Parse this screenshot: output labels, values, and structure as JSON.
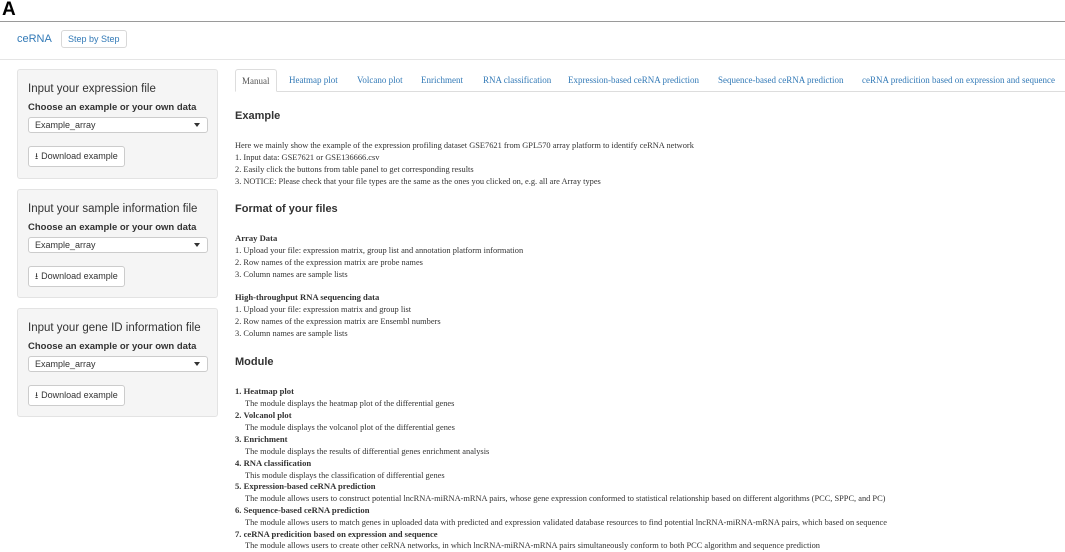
{
  "figure_label": "A",
  "navbar": {
    "brand": "ceRNA",
    "step_button": "Step by Step"
  },
  "sidebar": {
    "wells": [
      {
        "title": "Input your expression file",
        "subtitle": "Choose an example or your own data",
        "selected": "Example_array",
        "download": "Download example"
      },
      {
        "title": "Input your sample information file",
        "subtitle": "Choose an example or your own data",
        "selected": "Example_array",
        "download": "Download example"
      },
      {
        "title": "Input your gene ID information file",
        "subtitle": "Choose an example or your own data",
        "selected": "Example_array",
        "download": "Download example"
      }
    ]
  },
  "tabs": [
    "Manual",
    "Heatmap plot",
    "Volcano plot",
    "Enrichment",
    "RNA classification",
    "Expression-based ceRNA prediction",
    "Sequence-based ceRNA prediction",
    "ceRNA predicition based on expression and sequence"
  ],
  "main": {
    "example_heading": "Example",
    "example_lines": [
      "Here we mainly show the example of the expression profiling dataset GSE7621 from GPL570 array platform to identify ceRNA network",
      "1. Input data: GSE7621 or GSE136666.csv",
      "2. Easily click the buttons from table panel to get corresponding results",
      "3. NOTICE: Please check that your file types are the same as the ones you clicked on, e.g. all are Array types"
    ],
    "format_heading": "Format of your files",
    "array_title": "Array Data",
    "array_lines": [
      "1. Upload your file: expression matrix, group list and annotation platform information",
      "2. Row names of the expression matrix are probe names",
      "3. Column names are sample lists"
    ],
    "rnaseq_title": "High-throughput RNA sequencing data",
    "rnaseq_lines": [
      "1. Upload your file: expression matrix and group list",
      "2. Row names of the expression matrix are Ensembl numbers",
      "3. Column names are sample lists"
    ],
    "module_heading": "Module",
    "modules": [
      {
        "title": "1. Heatmap plot",
        "desc": "The module displays the heatmap plot of the differential genes"
      },
      {
        "title": "2. Volcanol plot",
        "desc": "The module displays the volcanol plot of the differential genes"
      },
      {
        "title": "3. Enrichment",
        "desc": "The module displays the results of differential genes enrichment analysis"
      },
      {
        "title": "4. RNA classification",
        "desc": "This module displays the classification of differential genes"
      },
      {
        "title": "5. Expression-based ceRNA prediction",
        "desc": "The module allows users to construct potential lncRNA-miRNA-mRNA pairs, whose gene expression conformed to statistical relationship based on different algorithms (PCC, SPPC, and PC)"
      },
      {
        "title": "6. Sequence-based ceRNA prediction",
        "desc": "The module allows users to match genes in uploaded data with predicted and expression validated database resources to find potential lncRNA-miRNA-mRNA pairs, which based on sequence"
      },
      {
        "title": "7. ceRNA predicition based on expression and sequence",
        "desc": "The module allows users to create other ceRNA networks, in which lncRNA-miRNA-mRNA pairs simultaneously conform to both PCC algorithm and sequence prediction"
      }
    ]
  }
}
